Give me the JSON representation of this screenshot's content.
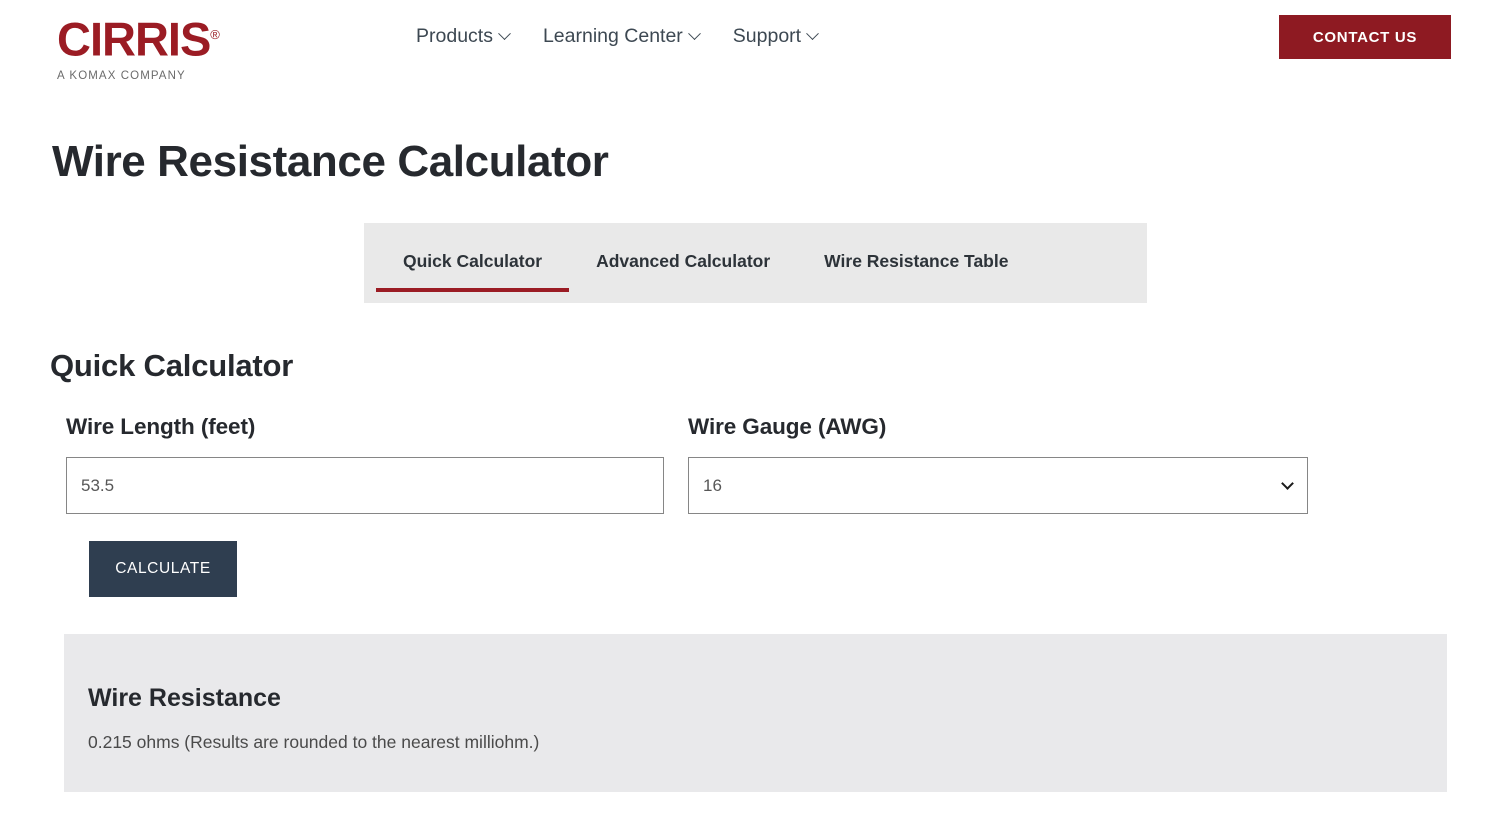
{
  "header": {
    "logo": {
      "wordmark": "CIRRIS",
      "registered_mark": "®",
      "tagline": "A KOMAX COMPANY",
      "color": "#9b1c24"
    },
    "nav": [
      {
        "label": "Products",
        "icon": "chevron-down-icon"
      },
      {
        "label": "Learning Center",
        "icon": "chevron-down-icon"
      },
      {
        "label": "Support",
        "icon": "chevron-down-icon"
      }
    ],
    "contact_button": {
      "label": "CONTACT US",
      "background": "#8e1a22",
      "text_color": "#ffffff"
    }
  },
  "page": {
    "title": "Wire Resistance Calculator"
  },
  "tabs": {
    "active_index": 0,
    "accent_color": "#9b1c24",
    "background": "#e9e9e9",
    "items": [
      {
        "label": "Quick Calculator"
      },
      {
        "label": "Advanced Calculator"
      },
      {
        "label": "Wire Resistance Table"
      }
    ]
  },
  "calculator": {
    "section_heading": "Quick Calculator",
    "length_field": {
      "label": "Wire Length (feet)",
      "value": "53.5",
      "placeholder": "53.5"
    },
    "gauge_field": {
      "label": "Wire Gauge (AWG)",
      "value": "16",
      "icon": "chevron-down-icon",
      "options": [
        "16"
      ]
    },
    "calculate_button": {
      "label": "CALCULATE",
      "background": "#2f3e50"
    }
  },
  "result": {
    "title": "Wire Resistance",
    "value_text": "0.215 ohms (Results are rounded to the nearest milliohm.)",
    "background": "#e9e9eb"
  }
}
